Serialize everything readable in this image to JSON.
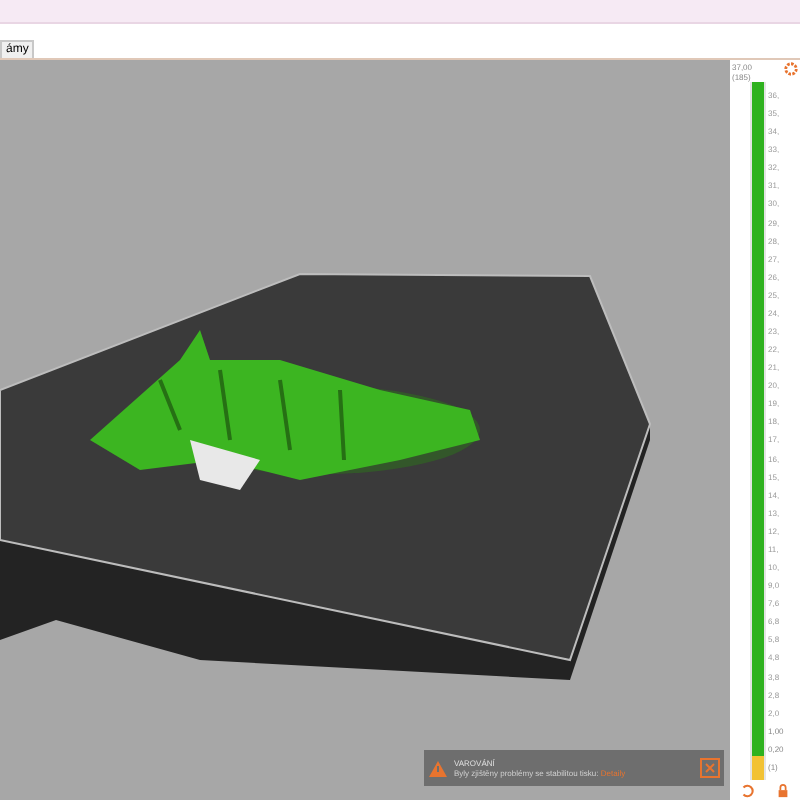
{
  "tabs": [
    {
      "label": "ámy",
      "selected": true
    }
  ],
  "layer_slider": {
    "top_value": "37,00",
    "top_layer": "(185)",
    "bottom_value": "1,00",
    "bottom_sub": "0,20",
    "bottom_layer": "(1)",
    "level": 1,
    "ticks": [
      "36,",
      "35,",
      "34,",
      "33,",
      "32,",
      "31,",
      "30,",
      "29,",
      "28,",
      "27,",
      "26,",
      "25,",
      "24,",
      "23,",
      "22,",
      "21,",
      "20,",
      "19,",
      "18,",
      "17,",
      "16,",
      "15,",
      "14,",
      "13,",
      "12,",
      "11,",
      "10,",
      "9,0",
      "7,6",
      "6,8",
      "5,8",
      "4,8",
      "3,8",
      "2,8",
      "2,0"
    ]
  },
  "notification": {
    "title": "VAROVÁNÍ",
    "message": "Byly zjištěny problémy se stabilitou tisku:",
    "link": "Detaily"
  }
}
